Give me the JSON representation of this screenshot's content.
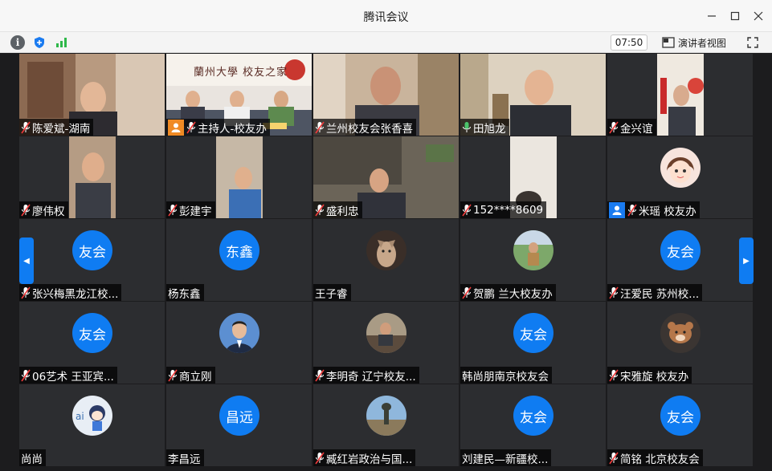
{
  "window": {
    "title": "腾讯会议"
  },
  "toolbar": {
    "timer": "07:50",
    "speaker_view_label": "演讲者视图",
    "icons": [
      "info-icon",
      "shield-icon",
      "signal-icon",
      "speaker-view-icon",
      "fullscreen-icon"
    ]
  },
  "colors": {
    "accent": "#0f7cf2",
    "active_speaker": "#4cc36b",
    "host_badge": "#f08a24"
  },
  "participants": [
    {
      "name": "陈爱斌-湖南",
      "type": "video"
    },
    {
      "name": "主持人-校友办",
      "type": "video",
      "banner": "蘭州大學 校友之家",
      "host": true
    },
    {
      "name": "兰州校友会张香喜",
      "type": "video"
    },
    {
      "name": "田旭龙",
      "type": "video",
      "active": true
    },
    {
      "name": "金兴谊",
      "type": "video"
    },
    {
      "name": "廖伟权",
      "type": "video"
    },
    {
      "name": "彭建宇",
      "type": "video"
    },
    {
      "name": "盛利忠",
      "type": "video"
    },
    {
      "name": "152****8609",
      "type": "video"
    },
    {
      "name": "米瑶 校友办",
      "type": "picture",
      "blue_badge": true
    },
    {
      "name": "张兴梅黑龙江校...",
      "type": "text",
      "avatar_text": "友会"
    },
    {
      "name": "杨东鑫",
      "type": "text",
      "avatar_text": "东鑫"
    },
    {
      "name": "王子睿",
      "type": "picture"
    },
    {
      "name": "贺鹏 兰大校友办",
      "type": "picture"
    },
    {
      "name": "汪爱民  苏州校...",
      "type": "text",
      "avatar_text": "友会"
    },
    {
      "name": "06艺术 王亚宾...",
      "type": "text",
      "avatar_text": "友会"
    },
    {
      "name": "商立刚",
      "type": "picture"
    },
    {
      "name": "李明奇 辽宁校友...",
      "type": "picture"
    },
    {
      "name": "韩尚朋南京校友会",
      "type": "text",
      "avatar_text": "友会"
    },
    {
      "name": "宋雅旋 校友办",
      "type": "picture"
    },
    {
      "name": "尚尚",
      "type": "picture"
    },
    {
      "name": "李昌远",
      "type": "text",
      "avatar_text": "昌远"
    },
    {
      "name": "臧红岩政治与国...",
      "type": "picture"
    },
    {
      "name": "刘建民—新疆校...",
      "type": "text",
      "avatar_text": "友会"
    },
    {
      "name": "简铭 北京校友会",
      "type": "text",
      "avatar_text": "友会"
    }
  ]
}
